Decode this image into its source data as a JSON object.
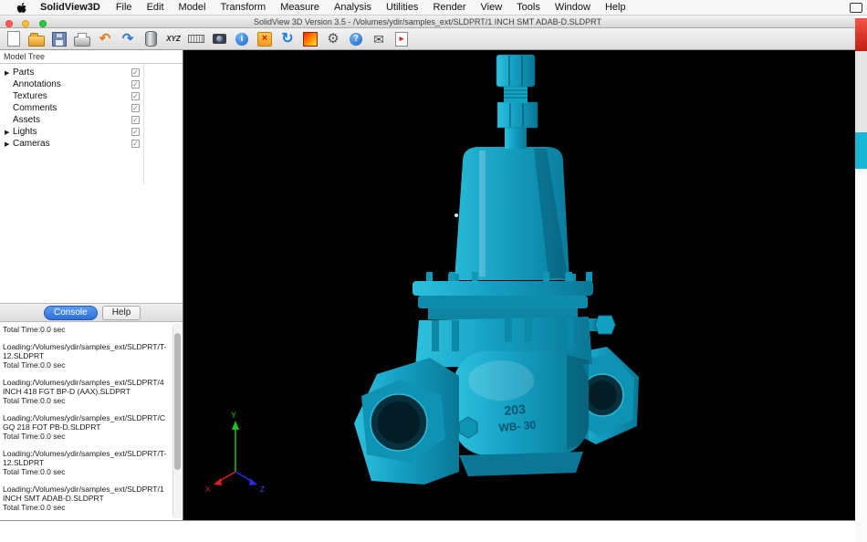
{
  "menubar": {
    "app_name": "SolidView3D",
    "items": [
      "File",
      "Edit",
      "Model",
      "Transform",
      "Measure",
      "Analysis",
      "Utilities",
      "Render",
      "View",
      "Tools",
      "Window",
      "Help"
    ]
  },
  "titlebar": {
    "title": "SolidView 3D Version 3.5 - /Volumes/ydir/samples_ext/SLDPRT/1 INCH SMT ADAB-D.SLDPRT"
  },
  "toolbar": {
    "buttons": [
      {
        "name": "new-file",
        "glyph": ""
      },
      {
        "name": "open",
        "glyph": ""
      },
      {
        "name": "save",
        "glyph": ""
      },
      {
        "name": "print",
        "glyph": ""
      },
      {
        "name": "undo",
        "glyph": "↶"
      },
      {
        "name": "redo",
        "glyph": "↷"
      },
      {
        "name": "cylinder",
        "glyph": ""
      },
      {
        "name": "xyz",
        "glyph": "XYZ"
      },
      {
        "name": "ruler",
        "glyph": ""
      },
      {
        "name": "camera",
        "glyph": ""
      },
      {
        "name": "info",
        "glyph": "i"
      },
      {
        "name": "delete",
        "glyph": "×"
      },
      {
        "name": "refresh",
        "glyph": "↻"
      },
      {
        "name": "render",
        "glyph": ""
      },
      {
        "name": "settings",
        "glyph": "⚙"
      },
      {
        "name": "help",
        "glyph": "?"
      },
      {
        "name": "email",
        "glyph": "✉"
      },
      {
        "name": "export",
        "glyph": "▸"
      }
    ]
  },
  "model_tree": {
    "header": "Model Tree",
    "items": [
      {
        "label": "Parts",
        "expandable": true,
        "checked": true
      },
      {
        "label": "Annotations",
        "expandable": false,
        "checked": true
      },
      {
        "label": "Textures",
        "expandable": false,
        "checked": true
      },
      {
        "label": "Comments",
        "expandable": false,
        "checked": true
      },
      {
        "label": "Assets",
        "expandable": false,
        "checked": true
      },
      {
        "label": "Lights",
        "expandable": true,
        "checked": true
      },
      {
        "label": "Cameras",
        "expandable": true,
        "checked": true
      }
    ]
  },
  "console_panel": {
    "tabs": [
      {
        "label": "Console",
        "active": true
      },
      {
        "label": "Help",
        "active": false
      }
    ],
    "leading_line": "Total Time:0.0 sec",
    "entries": [
      {
        "loading": "Loading:/Volumes/ydir/samples_ext/SLDPRT/T-12.SLDPRT",
        "time": "Total Time:0.0 sec"
      },
      {
        "loading": "Loading:/Volumes/ydir/samples_ext/SLDPRT/4 INCH 418 FGT BP-D (AAX).SLDPRT",
        "time": "Total Time:0.0 sec"
      },
      {
        "loading": "Loading:/Volumes/ydir/samples_ext/SLDPRT/CGQ 218 FOT PB-D.SLDPRT",
        "time": "Total Time:0.0 sec"
      },
      {
        "loading": "Loading:/Volumes/ydir/samples_ext/SLDPRT/T-12.SLDPRT",
        "time": "Total Time:0.0 sec"
      },
      {
        "loading": "Loading:/Volumes/ydir/samples_ext/SLDPRT/1 INCH SMT ADAB-D.SLDPRT",
        "time": "Total Time:0.0 sec"
      }
    ]
  },
  "viewport": {
    "background": "#000000",
    "model_color": "#15a9c9",
    "casting_mark_line1": "203",
    "casting_mark_line2": "WB- 30",
    "axis": {
      "x": "X",
      "y": "Y",
      "z": "Z"
    }
  }
}
